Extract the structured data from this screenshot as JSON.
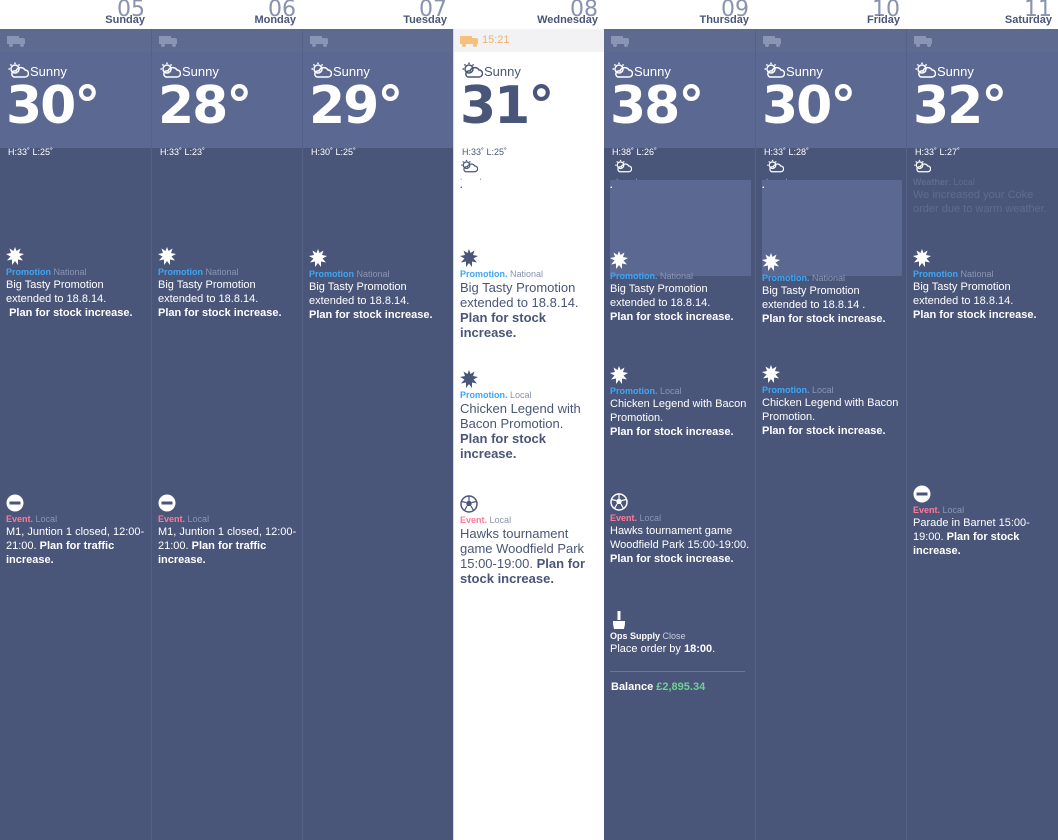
{
  "days": [
    {
      "num": "05",
      "name": "Sunday",
      "weather": "Sunny",
      "temp": "30°",
      "hilo": "H:33˚ L:25˚"
    },
    {
      "num": "06",
      "name": "Monday",
      "weather": "Sunny",
      "temp": "28°",
      "hilo": "H:33˚ L:23˚"
    },
    {
      "num": "07",
      "name": "Tuesday",
      "weather": "Sunny",
      "temp": "29°",
      "hilo": "H:30˚ L:25˚"
    },
    {
      "num": "08",
      "name": "Wednesday",
      "weather": "Sunny",
      "temp": "31°",
      "hilo": "H:33˚ L:25˚",
      "delivery_time": "15:21"
    },
    {
      "num": "09",
      "name": "Thursday",
      "weather": "Sunny",
      "temp": "38°",
      "hilo": "H:38˚ L:26˚"
    },
    {
      "num": "10",
      "name": "Friday",
      "weather": "Sunny",
      "temp": "30°",
      "hilo": "H:33˚ L:28˚"
    },
    {
      "num": "11",
      "name": "Saturday",
      "weather": "Sunny",
      "temp": "32°",
      "hilo": "H:33˚ L:27˚"
    }
  ],
  "labels": {
    "promotion": "Promotion",
    "event": "Event",
    "weather": "Weather",
    "ops": "Ops Supply",
    "national": "National",
    "local": "Local",
    "close": "Close",
    "plan_stock": "Plan for stock increase.",
    "plan_traffic": "Plan for traffic increase.",
    "balance": "Balance",
    "balance_amount": "£2,895.34"
  },
  "texts": {
    "bigtasty": "Big Tasty Promotion extended to 18.8.14.",
    "bigtasty_fri": "Big Tasty Promotion extended to 18.8.14 .",
    "chicken": "Chicken Legend with Bacon Promotion.",
    "coke": "We increased your Coke order due to warm weather.",
    "m1": "M1, Juntion 1  closed, 12:00-21:00.",
    "hawks_wed": "Hawks tournament game Woodfield Park 15:00-19:00.",
    "hawks_thu": "Hawks tournament game Woodfield Park 15:00-19:00.",
    "parade": "Parade in Barnet 15:00-19:00.",
    "order_by": "Place order by",
    "order_time": "18:00"
  },
  "colors": {
    "panel": "#4a5679",
    "weather_band": "#5b6891",
    "promo": "#3fa6f5",
    "event": "#ff7a9a",
    "balance": "#6fcf97",
    "delivery": "#f0b26a"
  }
}
